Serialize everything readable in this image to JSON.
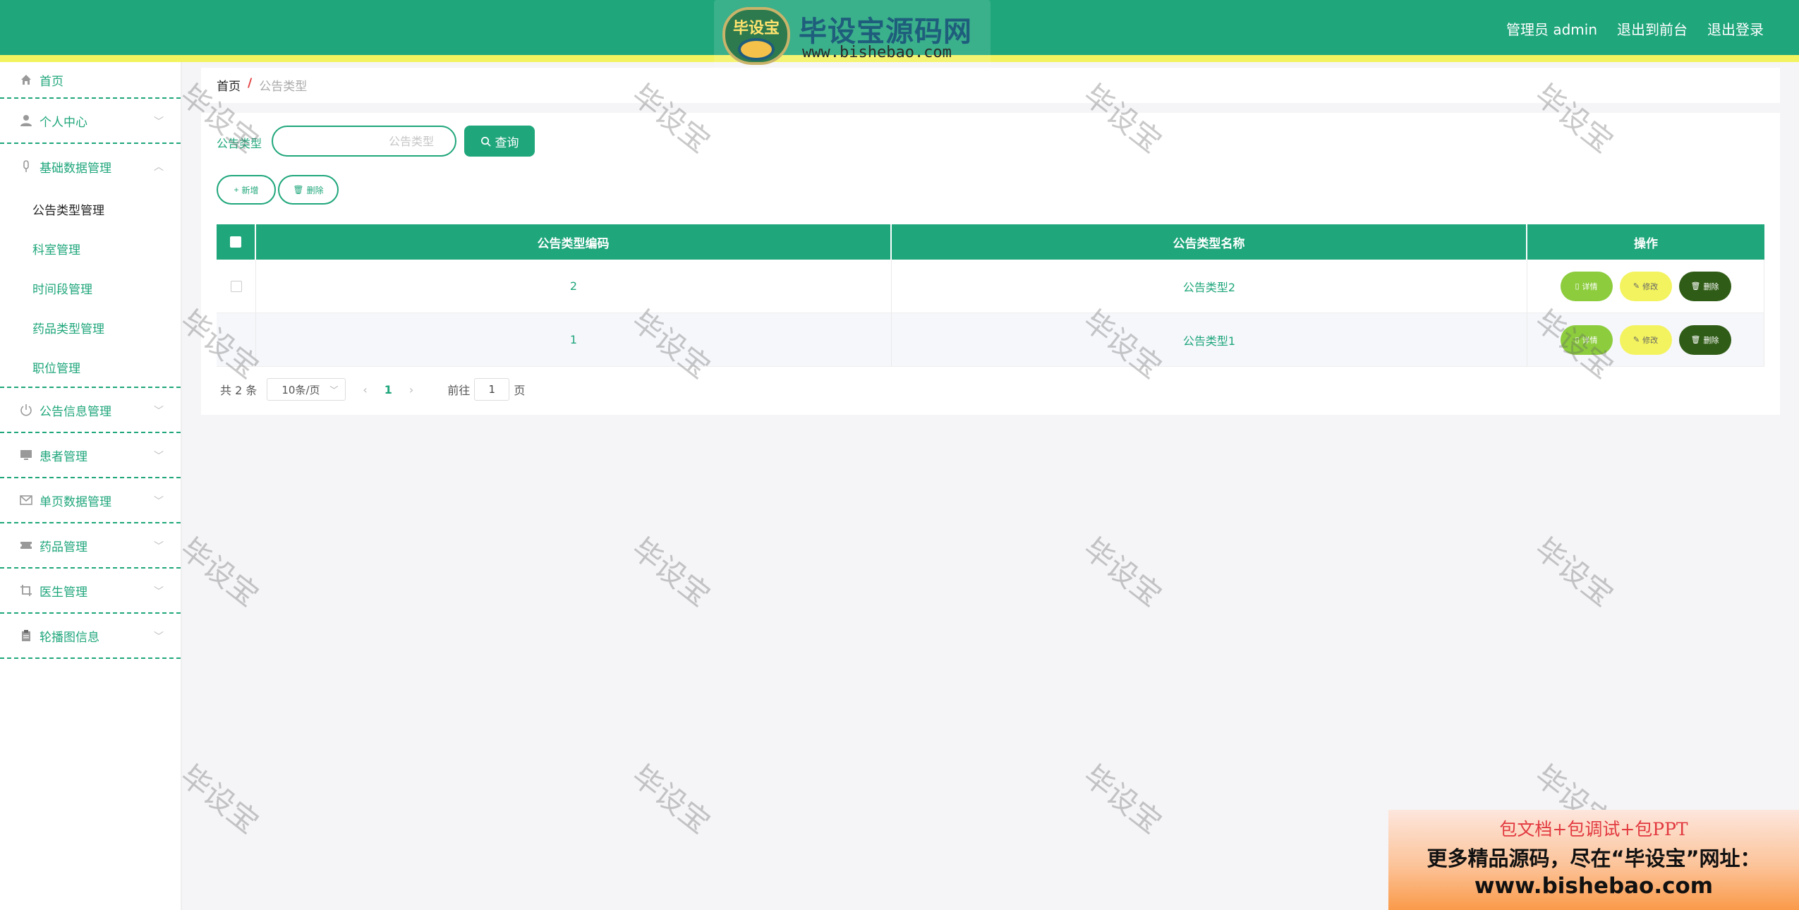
{
  "colors": {
    "primary": "#1fa67b",
    "stripe": "#f3f35f",
    "danger_dark": "#2f5c16",
    "detail": "#8ccc3d"
  },
  "logo": {
    "badge_text": "毕设宝",
    "title": "毕设宝源码网",
    "url": "www.bishebao.com"
  },
  "header": {
    "user_label": "管理员 admin",
    "to_front": "退出到前台",
    "logout": "退出登录"
  },
  "sidebar": {
    "home": {
      "label": "首页",
      "icon": "home-icon"
    },
    "menus": [
      {
        "label": "个人中心",
        "icon": "user-icon"
      },
      {
        "label": "基础数据管理",
        "icon": "mic-icon",
        "expanded": true,
        "children": [
          "公告类型管理",
          "科室管理",
          "时间段管理",
          "药品类型管理",
          "职位管理"
        ]
      },
      {
        "label": "公告信息管理",
        "icon": "power-icon"
      },
      {
        "label": "患者管理",
        "icon": "monitor-icon"
      },
      {
        "label": "单页数据管理",
        "icon": "mail-icon"
      },
      {
        "label": "药品管理",
        "icon": "ticket-icon"
      },
      {
        "label": "医生管理",
        "icon": "crop-icon"
      },
      {
        "label": "轮播图信息",
        "icon": "clipboard-icon"
      }
    ]
  },
  "breadcrumb": {
    "home": "首页",
    "sep": "/",
    "current": "公告类型"
  },
  "search": {
    "label": "公告类型",
    "placeholder": "公告类型",
    "button": "查询"
  },
  "actions": {
    "add": "新增",
    "delete": "删除"
  },
  "table": {
    "headers": [
      "公告类型编码",
      "公告类型名称",
      "操作"
    ],
    "rows": [
      {
        "code": "2",
        "name": "公告类型2"
      },
      {
        "code": "1",
        "name": "公告类型1"
      }
    ],
    "ops": {
      "detail": "详情",
      "edit": "修改",
      "delete": "删除"
    }
  },
  "pager": {
    "total": "共 2 条",
    "size": "10条/页",
    "page": "1",
    "goto": "前往",
    "goto_value": "1",
    "unit": "页"
  },
  "watermark": "毕设宝",
  "promo": {
    "line1": "包文档+包调试+包PPT",
    "line2": "更多精品源码，尽在“毕设宝”网址：",
    "line3": "www.bishebao.com"
  }
}
